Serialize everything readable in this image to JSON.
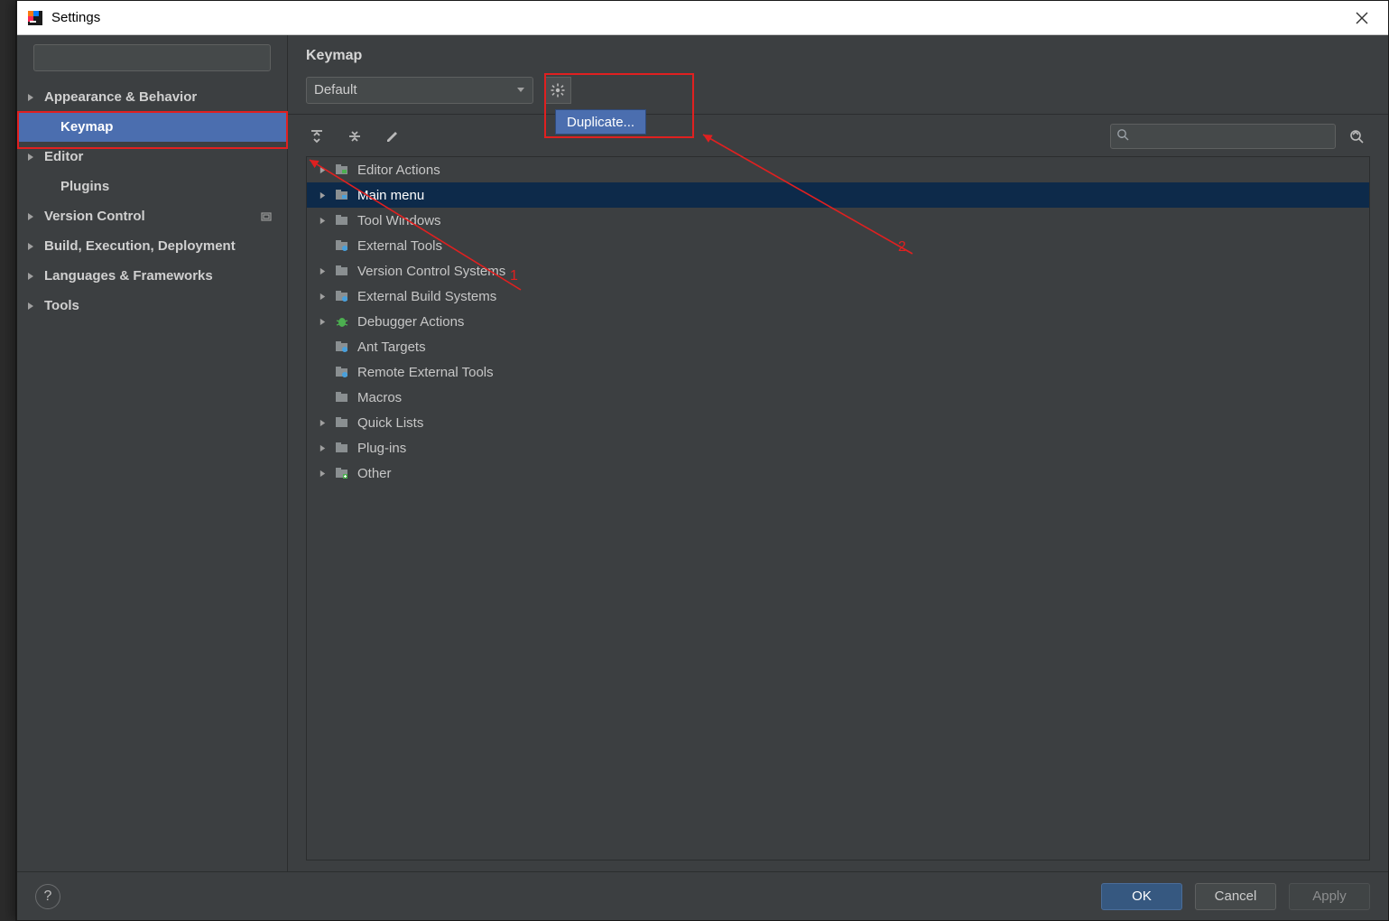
{
  "titlebar": {
    "title": "Settings"
  },
  "sidebar": {
    "search_placeholder": "",
    "items": [
      {
        "label": "Appearance & Behavior",
        "expandable": true,
        "bold": true
      },
      {
        "label": "Keymap",
        "expandable": false,
        "bold": true,
        "selected": true,
        "indent": true
      },
      {
        "label": "Editor",
        "expandable": true,
        "bold": true
      },
      {
        "label": "Plugins",
        "expandable": false,
        "bold": true,
        "indent": true
      },
      {
        "label": "Version Control",
        "expandable": true,
        "bold": true,
        "trail_icon": true
      },
      {
        "label": "Build, Execution, Deployment",
        "expandable": true,
        "bold": true
      },
      {
        "label": "Languages & Frameworks",
        "expandable": true,
        "bold": true
      },
      {
        "label": "Tools",
        "expandable": true,
        "bold": true
      }
    ]
  },
  "main": {
    "title": "Keymap",
    "combo_value": "Default",
    "gear_menu_item": "Duplicate...",
    "search_placeholder": "",
    "tree": [
      {
        "label": "Editor Actions",
        "expandable": true,
        "icon": "folder-green"
      },
      {
        "label": "Main menu",
        "expandable": true,
        "icon": "folder-blue",
        "selected": true
      },
      {
        "label": "Tool Windows",
        "expandable": true,
        "icon": "folder"
      },
      {
        "label": "External Tools",
        "expandable": false,
        "icon": "folder-gear"
      },
      {
        "label": "Version Control Systems",
        "expandable": true,
        "icon": "folder"
      },
      {
        "label": "External Build Systems",
        "expandable": true,
        "icon": "folder-gear"
      },
      {
        "label": "Debugger Actions",
        "expandable": true,
        "icon": "bug"
      },
      {
        "label": "Ant Targets",
        "expandable": false,
        "icon": "folder-gear"
      },
      {
        "label": "Remote External Tools",
        "expandable": false,
        "icon": "folder-gear"
      },
      {
        "label": "Macros",
        "expandable": false,
        "icon": "folder"
      },
      {
        "label": "Quick Lists",
        "expandable": true,
        "icon": "folder"
      },
      {
        "label": "Plug-ins",
        "expandable": true,
        "icon": "folder"
      },
      {
        "label": "Other",
        "expandable": true,
        "icon": "folder-plus"
      }
    ]
  },
  "footer": {
    "help": "?",
    "ok": "OK",
    "cancel": "Cancel",
    "apply": "Apply"
  },
  "annotations": {
    "label1": "1",
    "label2": "2"
  }
}
